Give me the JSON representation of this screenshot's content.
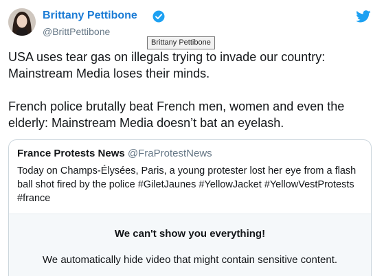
{
  "author": {
    "display_name": "Brittany Pettibone",
    "handle": "@BrittPettibone",
    "verified": true,
    "tooltip": "Brittany Pettibone"
  },
  "tweet": {
    "paragraphs": [
      "USA uses tear gas on illegals trying to invade our country: Mainstream Media loses their minds.",
      "French police brutally beat French men, women and even the elderly: Mainstream Media doesn’t bat an eyelash."
    ]
  },
  "quoted_tweet": {
    "name": "France Protests News",
    "handle": "@FraProtestNews",
    "text": "Today on Champs-Élysées, Paris, a young protester lost her eye from a flash ball shot fired by the police #GiletJaunes #YellowJacket #YellowVestProtests #france",
    "sensitive_notice": {
      "title": "We can't show you everything!",
      "body": "We automatically hide video that might contain sensitive content."
    }
  },
  "colors": {
    "link_blue": "#1c7cd5",
    "twitter_blue": "#1da1f2",
    "secondary_text": "#657786"
  },
  "icons": {
    "verified": "verified-badge-icon",
    "brand": "twitter-bird-icon"
  }
}
